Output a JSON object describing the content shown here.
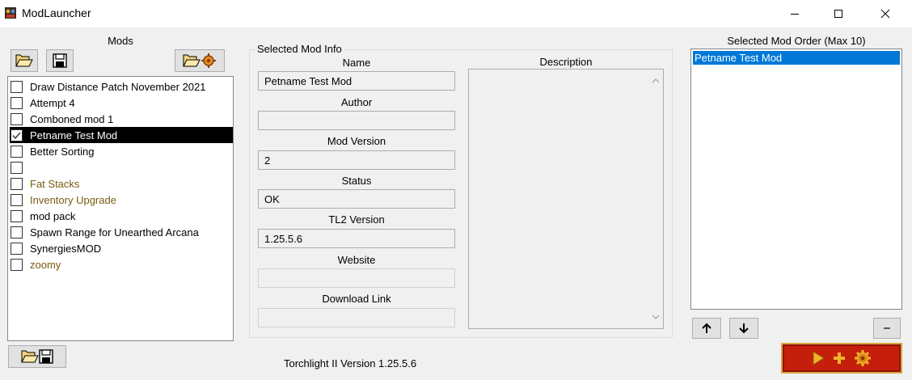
{
  "window": {
    "title": "ModLauncher",
    "minimize_glyph": "—",
    "maximize_glyph": "☐",
    "close_glyph": "✕"
  },
  "mods_panel": {
    "title": "Mods",
    "open_icon": "open-folder-icon",
    "save_icon": "floppy-save-icon",
    "folder_gear_icon": "folder-gear-icon",
    "items": [
      {
        "name": "Draw Distance Patch November 2021",
        "checked": false,
        "selected": false,
        "color": "#000000"
      },
      {
        "name": "Attempt 4",
        "checked": false,
        "selected": false,
        "color": "#000000"
      },
      {
        "name": "Comboned mod 1",
        "checked": false,
        "selected": false,
        "color": "#000000"
      },
      {
        "name": "Petname Test Mod",
        "checked": true,
        "selected": true,
        "color": "#ffffff"
      },
      {
        "name": "Better Sorting",
        "checked": false,
        "selected": false,
        "color": "#000000"
      },
      {
        "name": "",
        "checked": false,
        "selected": false,
        "color": "#000000"
      },
      {
        "name": "Fat Stacks",
        "checked": false,
        "selected": false,
        "color": "#7a5a12"
      },
      {
        "name": "Inventory Upgrade",
        "checked": false,
        "selected": false,
        "color": "#7a5a12"
      },
      {
        "name": "mod pack",
        "checked": false,
        "selected": false,
        "color": "#000000"
      },
      {
        "name": "Spawn Range for Unearthed Arcana",
        "checked": false,
        "selected": false,
        "color": "#000000"
      },
      {
        "name": "SynergiesMOD",
        "checked": false,
        "selected": false,
        "color": "#000000"
      },
      {
        "name": "zoomy",
        "checked": false,
        "selected": false,
        "color": "#7a5a12"
      }
    ],
    "bottom_button_icon": "folder-save-icon"
  },
  "info": {
    "group_title": "Selected Mod Info",
    "name_label": "Name",
    "name_value": "Petname Test Mod",
    "author_label": "Author",
    "author_value": "",
    "mod_version_label": "Mod Version",
    "mod_version_value": "2",
    "status_label": "Status",
    "status_value": "OK",
    "tl2_version_label": "TL2 Version",
    "tl2_version_value": "1.25.5.6",
    "website_label": "Website",
    "website_value": "",
    "download_label": "Download Link",
    "download_value": "",
    "description_label": "Description",
    "description_value": ""
  },
  "order_panel": {
    "title": "Selected Mod Order (Max 10)",
    "items": [
      "Petname Test Mod"
    ],
    "up_glyph": "🡑",
    "down_glyph": "🡓",
    "remove_glyph": "–"
  },
  "footer": {
    "version_text": "Torchlight II Version 1.25.5.6",
    "launch_icons": [
      "play-icon",
      "plus-icon",
      "gear-icon"
    ]
  },
  "colors": {
    "selection_blue": "#0078d7",
    "launch_red": "#c51f0c",
    "launch_gold": "#f0b428",
    "mod_brown": "#7a5a12"
  }
}
